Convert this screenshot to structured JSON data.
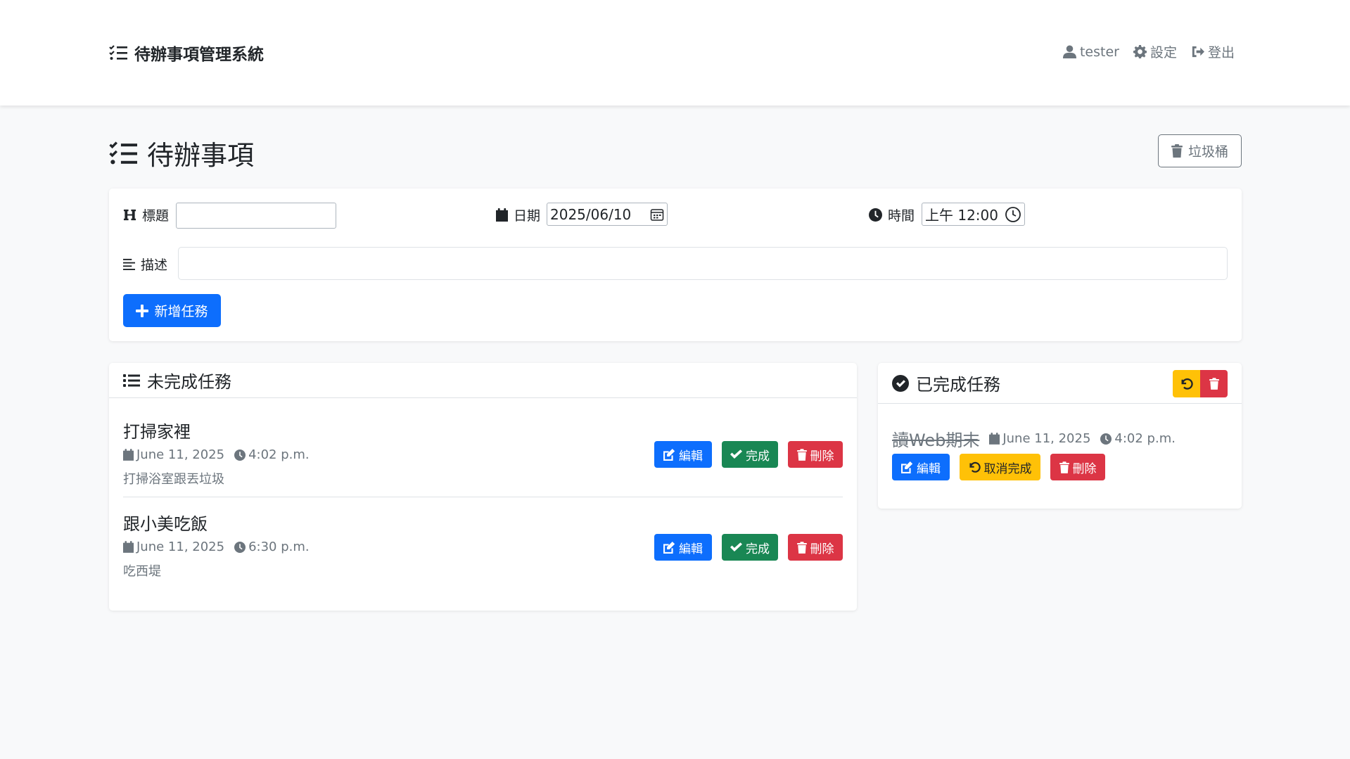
{
  "navbar": {
    "brand": "待辦事項管理系統",
    "user": "tester",
    "settings": "設定",
    "logout": "登出"
  },
  "page": {
    "title": "待辦事項",
    "trash_button": "垃圾桶"
  },
  "form": {
    "title_label": "標題",
    "title_value": "",
    "date_label": "日期",
    "date_value": "2025/06/10",
    "time_label": "時間",
    "time_value": "上午 12:00",
    "desc_label": "描述",
    "desc_value": "",
    "add_button": "新增任務"
  },
  "pending": {
    "header": "未完成任務",
    "tasks": [
      {
        "title": "打掃家裡",
        "date": "June 11, 2025",
        "time": "4:02 p.m.",
        "desc": "打掃浴室跟丟垃圾",
        "edit": "編輯",
        "done": "完成",
        "delete": "刪除"
      },
      {
        "title": "跟小美吃飯",
        "date": "June 11, 2025",
        "time": "6:30 p.m.",
        "desc": "吃西堤",
        "edit": "編輯",
        "done": "完成",
        "delete": "刪除"
      }
    ]
  },
  "completed": {
    "header": "已完成任務",
    "tasks": [
      {
        "title": "讀Web期末",
        "date": "June 11, 2025",
        "time": "4:02 p.m.",
        "edit": "編輯",
        "undo": "取消完成",
        "delete": "刪除"
      }
    ]
  },
  "colors": {
    "primary": "#0d6efd",
    "success": "#198754",
    "danger": "#dc3545",
    "warning": "#ffc107",
    "secondary": "#6c757d"
  }
}
